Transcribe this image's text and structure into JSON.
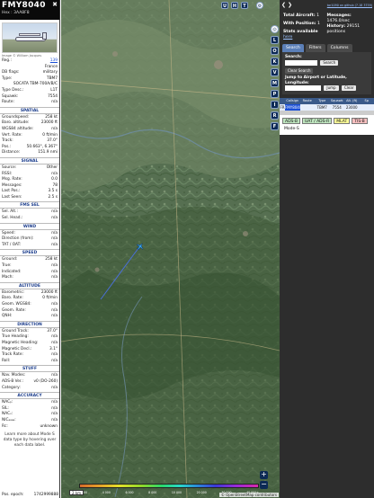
{
  "aircraft": {
    "flight": "FMY8040",
    "hex_label": "Hex :",
    "hex": "3AA8F8",
    "photo_credit": "Image © William Jacques"
  },
  "details": [
    {
      "label": "Reg.:",
      "value": "139",
      "link": true
    },
    {
      "label": "",
      "value": "France"
    },
    {
      "label": "DB flags:",
      "value": "military"
    },
    {
      "label": "Type:",
      "value": "TBM7"
    },
    {
      "label": "",
      "value": "SOCATA TBM-700A/B/C"
    },
    {
      "label": "Type Desc.:",
      "value": "L1T"
    },
    {
      "label": "Squawk:",
      "value": "7554"
    },
    {
      "label": "Route:",
      "value": "n/a"
    }
  ],
  "sections": [
    {
      "title": "SPATIAL",
      "rows": [
        {
          "label": "Groundspeed:",
          "value": "258 kt"
        },
        {
          "label": "Baro. altitude:",
          "value": "23000 ft"
        },
        {
          "label": "WGS84 altitude:",
          "value": "n/a"
        },
        {
          "label": "Vert. Rate:",
          "value": "0 ft/min"
        },
        {
          "label": "Track:",
          "value": "37.0°"
        },
        {
          "label": "Pos.:",
          "value": "50.663°, 6.367°"
        },
        {
          "label": "Distance:",
          "value": "151.9 nmi"
        }
      ]
    },
    {
      "title": "SIGNAL",
      "rows": [
        {
          "label": "Source:",
          "value": "Other"
        },
        {
          "label": "RSSI:",
          "value": "n/a"
        },
        {
          "label": "Msg. Rate:",
          "value": "0.0"
        },
        {
          "label": "Messages:",
          "value": "78"
        },
        {
          "label": "Last Pos.:",
          "value": "3.5 s"
        },
        {
          "label": "Last Seen:",
          "value": "2.5 s"
        }
      ]
    },
    {
      "title": "FMS SEL",
      "rows": [
        {
          "label": "Sel. Alt.:",
          "value": "n/a"
        },
        {
          "label": "Sel. Head.:",
          "value": "n/a"
        }
      ]
    },
    {
      "title": "WIND",
      "rows": [
        {
          "label": "Speed:",
          "value": "n/a"
        },
        {
          "label": "Direction (from):",
          "value": "n/a"
        },
        {
          "label": "TAT / OAT:",
          "value": "n/a"
        }
      ]
    },
    {
      "title": "SPEED",
      "rows": [
        {
          "label": "Ground:",
          "value": "258 kt"
        },
        {
          "label": "True:",
          "value": "n/a"
        },
        {
          "label": "Indicated:",
          "value": "n/a"
        },
        {
          "label": "Mach:",
          "value": "n/a"
        }
      ]
    },
    {
      "title": "ALTITUDE",
      "rows": [
        {
          "label": "Barometric:",
          "value": "23000 ft"
        },
        {
          "label": "Baro. Rate:",
          "value": "0 ft/min"
        },
        {
          "label": "Geom. WGS84:",
          "value": "n/a"
        },
        {
          "label": "Geom. Rate:",
          "value": "n/a"
        },
        {
          "label": "QNH:",
          "value": "n/a"
        }
      ]
    },
    {
      "title": "DIRECTION",
      "rows": [
        {
          "label": "Ground Track:",
          "value": "37.0°"
        },
        {
          "label": "True Heading:",
          "value": "n/a"
        },
        {
          "label": "Magnetic Heading:",
          "value": "n/a"
        },
        {
          "label": "Magnetic Decl.:",
          "value": "3.1°"
        },
        {
          "label": "Track Rate:",
          "value": "n/a"
        },
        {
          "label": "Roll:",
          "value": "n/a"
        }
      ]
    },
    {
      "title": "STUFF",
      "rows": [
        {
          "label": "Nav. Modes:",
          "value": "n/a"
        },
        {
          "label": "ADS-B Ver.:",
          "value": "v0 (DO-260)"
        },
        {
          "label": "Category:",
          "value": "n/a"
        }
      ]
    },
    {
      "title": "ACCURACY",
      "rows": [
        {
          "label": "NACₚ:",
          "value": "n/a"
        },
        {
          "label": "SIL:",
          "value": "n/a"
        },
        {
          "label": "NACᵥ:",
          "value": "n/a"
        },
        {
          "label": "NICₐₐₐₐ:",
          "value": "n/a"
        },
        {
          "label": "Rᴄ:",
          "value": "unknown"
        }
      ]
    }
  ],
  "note": "Learn more about Mode S data type by hovering over each data label.",
  "epoch": {
    "label": "Pos. epoch:",
    "value": "1742999888"
  },
  "map": {
    "buttons": [
      "U",
      "H",
      "T"
    ],
    "toggles": [
      "L",
      "O",
      "K",
      "V",
      "M",
      "P",
      "I",
      "R",
      "F"
    ],
    "scale": "2 km",
    "altitude_ticks": [
      "2 000",
      "4 000",
      "6 000",
      "8 000",
      "10 000",
      "20 000",
      "30 000",
      "40 000+"
    ],
    "credit": "© OpenStreetMap contributors",
    "track_color": "#4a6fd8",
    "aircraft_color": "#39a0e8"
  },
  "sidebar": {
    "version": "tar1090 on github (7.18 3759)",
    "total_label": "Total Aircraft:",
    "total": "1",
    "with_pos_label": "With Position:",
    "with_pos": "1",
    "stats_label": "Stats available",
    "stats_link": "here",
    "messages_label": "Messages:",
    "messages": "1476.0/sec",
    "history_label": "History:",
    "history": "29151 positions",
    "tabs": [
      "Search",
      "Filters",
      "Columns"
    ],
    "search_label": "Search:",
    "search_button": "Search",
    "clear_button": "Clear Search",
    "jump_label": "Jump to Airport or Latitude, Longitude:",
    "jump_button": "Jump",
    "jump_clear": "Clear",
    "table_headers": [
      "",
      "Callsign",
      "Route",
      "Type",
      "Squawk",
      "Alt. (ft)",
      "Sp"
    ],
    "table_row": {
      "flag": "FR",
      "callsign": "FMY8040",
      "route": "",
      "type": "TBM7",
      "squawk": "7554",
      "alt": "23000",
      "speed": ""
    },
    "legend": [
      "ADS-B",
      "UAT / ADS-R",
      "MLAT",
      "TIS-B",
      "Mode-S"
    ]
  }
}
